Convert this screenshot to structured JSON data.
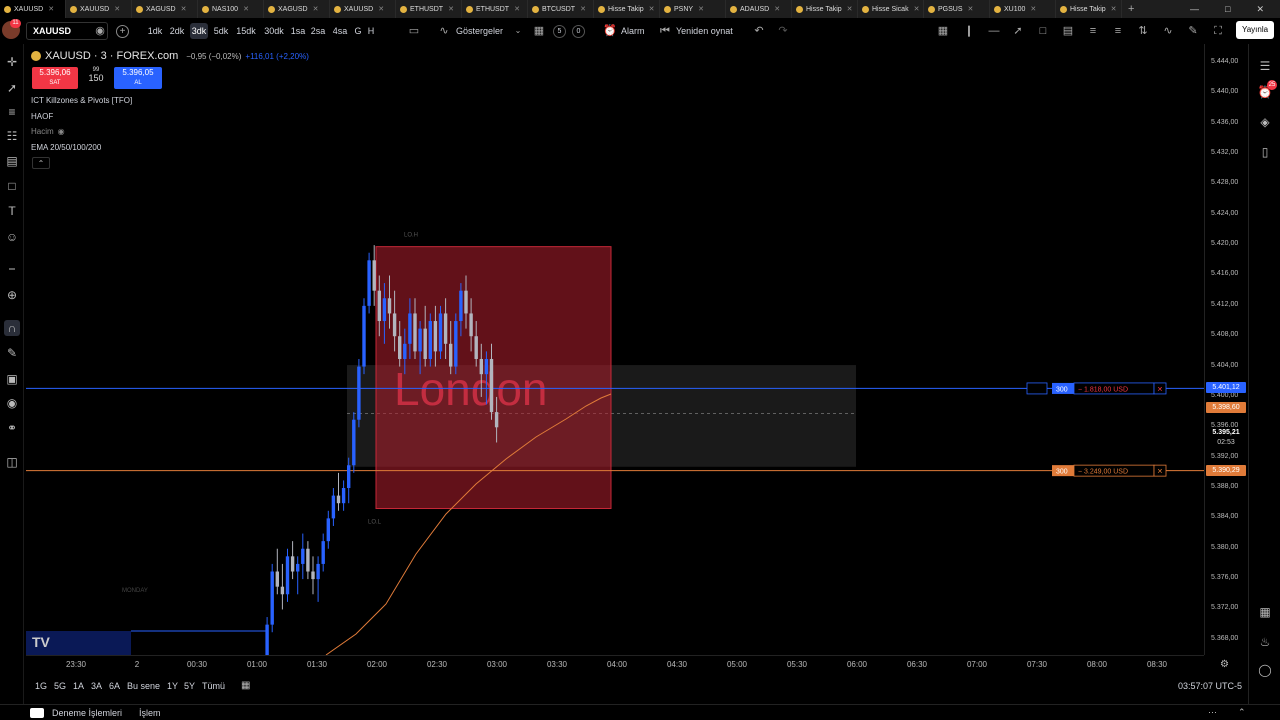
{
  "tabs": [
    {
      "label": "XAUUSD",
      "active": true
    },
    {
      "label": "XAUUSD"
    },
    {
      "label": "XAGUSD"
    },
    {
      "label": "NAS100"
    },
    {
      "label": "XAGUSD"
    },
    {
      "label": "XAUUSD"
    },
    {
      "label": "ETHUSDT"
    },
    {
      "label": "ETHUSDT"
    },
    {
      "label": "BTCUSDT"
    },
    {
      "label": "Hisse Takip"
    },
    {
      "label": "PSNY"
    },
    {
      "label": "ADAUSD"
    },
    {
      "label": "Hisse Takip"
    },
    {
      "label": "Hisse Sicak"
    },
    {
      "label": "PGSUS"
    },
    {
      "label": "XU100"
    },
    {
      "label": "Hisse Takip"
    }
  ],
  "notification_count": "11",
  "symbol": "XAUUSD",
  "toolbar": {
    "timeframes": [
      "1dk",
      "2dk",
      "3dk",
      "5dk",
      "15dk",
      "30dk",
      "1sa",
      "2sa",
      "4sa",
      "H",
      "G"
    ],
    "active_timeframe": "3dk",
    "indicators_label": "Göstergeler",
    "layout_count": "5",
    "alarm_label": "Alarm",
    "replay_label": "Yeniden oynat",
    "publish_label": "Yayınla"
  },
  "legend": {
    "title": "XAUUSD · 3 · FOREX.com",
    "change": "−0,95 (−0,02%)",
    "volume_change": "+116,01 (+2,20%)",
    "sell_price": "5.396,06",
    "sell_label": "SAT",
    "spread_top": "99",
    "spread": "150",
    "buy_price": "5.396,05",
    "buy_label": "AL",
    "indicators": [
      "ICT Killzones & Pivots [TFO]",
      "HAOF",
      "Hacim",
      "EMA 20/50/100/200"
    ]
  },
  "chart_data": {
    "type": "candlestick",
    "price_ticks": [
      "5.444,00",
      "5.440,00",
      "5.436,00",
      "5.432,00",
      "5.428,00",
      "5.424,00",
      "5.420,00",
      "5.416,00",
      "5.412,00",
      "5.408,00",
      "5.404,00",
      "5.400,00",
      "5.396,00",
      "5.392,00",
      "5.388,00",
      "5.384,00",
      "5.380,00",
      "5.376,00",
      "5.372,00",
      "5.368,00"
    ],
    "time_ticks": [
      "23:30",
      "2",
      "00:30",
      "01:00",
      "01:30",
      "02:00",
      "02:30",
      "03:00",
      "03:30",
      "04:00",
      "04:30",
      "05:00",
      "05:30",
      "06:00",
      "06:30",
      "07:00",
      "07:30",
      "08:00",
      "08:30"
    ],
    "ylim": [
      5366.0,
      5446.5
    ],
    "killzone": {
      "label": "London",
      "high_label": "LO.H",
      "low_label": "LO.L",
      "high": 5419.8,
      "low": 5385.3
    },
    "session_label": "MONDAY",
    "current_price": "5.395,21",
    "countdown": "02:53",
    "ema_price": "5.398,60",
    "order_line_1": {
      "price": 5401.12,
      "price_label": "5.401,12",
      "qty": "300",
      "pnl": "− 1.818,00 USD"
    },
    "order_line_2": {
      "price": 5390.29,
      "price_label": "5.390,29",
      "qty": "300",
      "pnl": "− 3.249,00 USD"
    },
    "up_color": "#2962ff",
    "down_color": "#b2b5be",
    "ema_color": "#e07b39",
    "candles": [
      [
        5363,
        5366,
        5361,
        5365
      ],
      [
        5365,
        5371,
        5364,
        5370
      ],
      [
        5370,
        5378,
        5369,
        5377
      ],
      [
        5377,
        5380,
        5374,
        5375
      ],
      [
        5375,
        5378,
        5372,
        5374
      ],
      [
        5374,
        5380,
        5373,
        5379
      ],
      [
        5379,
        5381,
        5376,
        5377
      ],
      [
        5377,
        5379,
        5374,
        5378
      ],
      [
        5378,
        5382,
        5376,
        5380
      ],
      [
        5380,
        5381,
        5376,
        5377
      ],
      [
        5377,
        5379,
        5374,
        5376
      ],
      [
        5376,
        5379,
        5373,
        5378
      ],
      [
        5378,
        5382,
        5377,
        5381
      ],
      [
        5381,
        5385,
        5380,
        5384
      ],
      [
        5384,
        5388,
        5383,
        5387
      ],
      [
        5387,
        5390,
        5385,
        5386
      ],
      [
        5386,
        5389,
        5385,
        5388
      ],
      [
        5388,
        5392,
        5386,
        5391
      ],
      [
        5391,
        5398,
        5390,
        5397
      ],
      [
        5397,
        5405,
        5396,
        5404
      ],
      [
        5404,
        5413,
        5403,
        5412
      ],
      [
        5412,
        5419,
        5411,
        5418
      ],
      [
        5418,
        5420,
        5412,
        5414
      ],
      [
        5414,
        5416,
        5408,
        5410
      ],
      [
        5410,
        5415,
        5407,
        5413
      ],
      [
        5413,
        5416,
        5409,
        5411
      ],
      [
        5411,
        5414,
        5406,
        5408
      ],
      [
        5408,
        5410,
        5404,
        5405
      ],
      [
        5405,
        5409,
        5403,
        5407
      ],
      [
        5407,
        5413,
        5405,
        5411
      ],
      [
        5411,
        5413,
        5405,
        5406
      ],
      [
        5406,
        5410,
        5403,
        5409
      ],
      [
        5409,
        5412,
        5404,
        5405
      ],
      [
        5405,
        5411,
        5404,
        5410
      ],
      [
        5410,
        5412,
        5404,
        5406
      ],
      [
        5406,
        5412,
        5405,
        5411
      ],
      [
        5411,
        5413,
        5405,
        5407
      ],
      [
        5407,
        5410,
        5403,
        5404
      ],
      [
        5404,
        5411,
        5403,
        5410
      ],
      [
        5410,
        5415,
        5408,
        5414
      ],
      [
        5414,
        5416,
        5409,
        5411
      ],
      [
        5411,
        5413,
        5406,
        5408
      ],
      [
        5408,
        5410,
        5404,
        5405
      ],
      [
        5405,
        5407,
        5400,
        5403
      ],
      [
        5403,
        5406,
        5399,
        5405
      ],
      [
        5405,
        5407,
        5397,
        5398
      ],
      [
        5398,
        5400,
        5394,
        5396
      ]
    ]
  },
  "range_bar": {
    "ranges": [
      "1G",
      "5G",
      "1A",
      "3A",
      "6A",
      "Bu sene",
      "1Y",
      "5Y",
      "Tümü"
    ],
    "clock": "03:57:07 UTC-5"
  },
  "bottom_bar": {
    "tab1": "Deneme İşlemleri",
    "tab2": "İşlem"
  }
}
